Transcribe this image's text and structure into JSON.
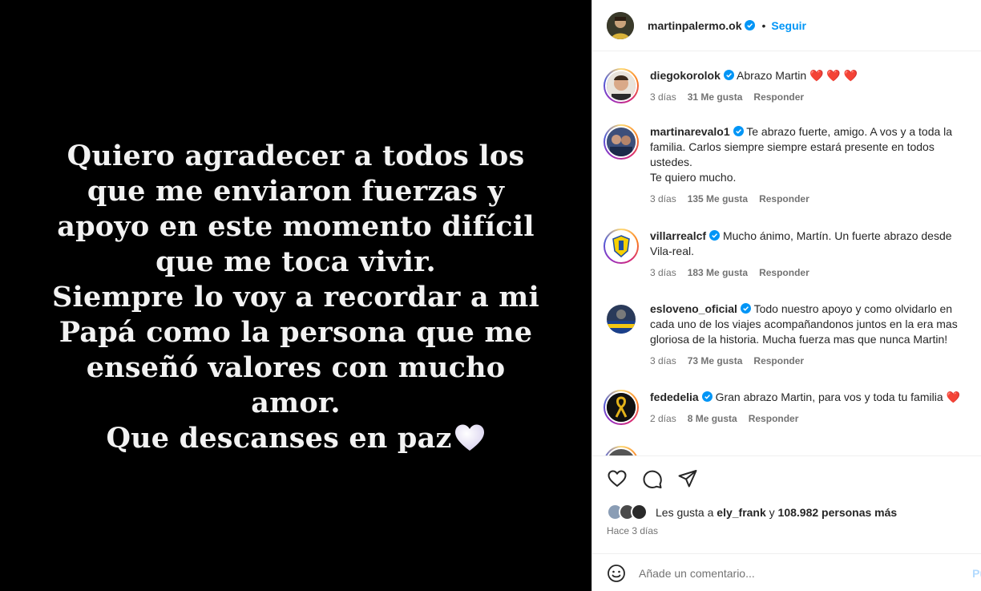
{
  "story": {
    "lines": [
      "Quiero agradecer a todos los",
      "que me enviaron fuerzas y",
      "apoyo en este momento difícil",
      "que me toca vivir.",
      "Siempre lo voy a recordar a mi",
      "Papá como la persona que me",
      "enseñó valores con mucho",
      "amor.",
      "Que descanses en paz"
    ]
  },
  "header": {
    "username": "martinpalermo.ok",
    "separator": "•",
    "follow_label": "Seguir"
  },
  "comments": [
    {
      "username": "diegokorolok",
      "lines": [
        "Abrazo Martin ❤️ ❤️ ❤️"
      ],
      "time": "3 días",
      "likes": "31 Me gusta",
      "reply": "Responder"
    },
    {
      "username": "martinarevalo1",
      "lines": [
        "Te abrazo fuerte, amigo. A vos y a toda la",
        "familia. Carlos siempre siempre estará presente en todos",
        "ustedes.",
        "Te quiero mucho."
      ],
      "time": "3 días",
      "likes": "135 Me gusta",
      "reply": "Responder"
    },
    {
      "username": "villarrealcf",
      "lines": [
        "Mucho ánimo, Martín. Un fuerte abrazo desde",
        "Vila-real."
      ],
      "time": "3 días",
      "likes": "183 Me gusta",
      "reply": "Responder"
    },
    {
      "username": "esloveno_oficial",
      "lines": [
        "Todo nuestro apoyo y como olvidarlo en",
        "cada uno de los viajes acompañandonos juntos en la era mas",
        "gloriosa de la historia. Mucha fuerza mas que nunca Martin!"
      ],
      "time": "3 días",
      "likes": "73 Me gusta",
      "reply": "Responder"
    },
    {
      "username": "fededelia",
      "lines": [
        "Gran abrazo Martin, para vos y toda tu familia ❤️"
      ],
      "time": "2 días",
      "likes": "8 Me gusta",
      "reply": "Responder"
    }
  ],
  "actions": {
    "likes_prefix": "Les gusta a",
    "likes_user": "ely_frank",
    "likes_and": "y",
    "likes_others": "108.982 personas más",
    "time_ago": "Hace 3 días",
    "comment_placeholder": "Añade un comentario...",
    "publish_label": "Pu"
  },
  "icons": [
    "verified-icon",
    "heart-icon",
    "comment-icon",
    "share-icon",
    "emoji-icon",
    "white-heart-icon"
  ],
  "colors": {
    "accent": "#0095f6",
    "media_bg": "#000000",
    "verified": "#0095f6",
    "muted": "#737373"
  }
}
